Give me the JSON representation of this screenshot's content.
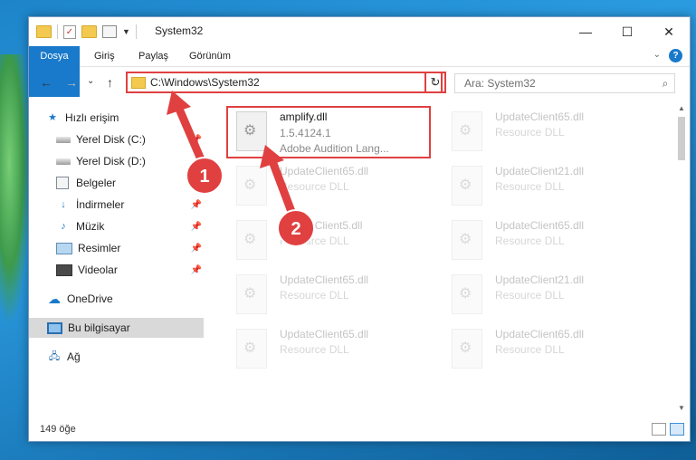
{
  "window": {
    "title": "System32",
    "minimize": "—",
    "maximize": "☐",
    "close": "✕"
  },
  "ribbon": {
    "tabs": [
      "Dosya",
      "Giriş",
      "Paylaş",
      "Görünüm"
    ],
    "help": "?"
  },
  "nav": {
    "back": "←",
    "forward": "→",
    "recent": "⌄",
    "up": "↑"
  },
  "address": {
    "path": "C:\\Windows\\System32",
    "refresh": "↻"
  },
  "search": {
    "placeholder": "Ara: System32",
    "icon": "search-icon"
  },
  "sidebar": {
    "items": [
      {
        "label": "Hızlı erişim",
        "icon": "star-icon"
      },
      {
        "label": "Yerel Disk (C:)",
        "icon": "drive-icon"
      },
      {
        "label": "Yerel Disk (D:)",
        "icon": "drive-icon"
      },
      {
        "label": "Belgeler",
        "icon": "documents-icon"
      },
      {
        "label": "İndirmeler",
        "icon": "download-icon"
      },
      {
        "label": "Müzik",
        "icon": "music-icon"
      },
      {
        "label": "Resimler",
        "icon": "pictures-icon"
      },
      {
        "label": "Videolar",
        "icon": "video-icon"
      },
      {
        "label": "OneDrive",
        "icon": "cloud-icon"
      },
      {
        "label": "Bu bilgisayar",
        "icon": "computer-icon"
      },
      {
        "label": "Ağ",
        "icon": "network-icon"
      }
    ]
  },
  "files": [
    {
      "name": "amplify.dll",
      "line1": "1.5.4124.1",
      "line2": "Adobe Audition Lang..."
    },
    {
      "name": "UpdateClient65.dll",
      "line1": "Resource DLL"
    },
    {
      "name": "UpdateClient65.dll",
      "line1": "Resource DLL"
    },
    {
      "name": "UpdateClient21.dll",
      "line1": "Resource DLL"
    },
    {
      "name": "UpdateClient5.dll",
      "line1": "Resource DLL"
    },
    {
      "name": "UpdateClient65.dll",
      "line1": "Resource DLL"
    },
    {
      "name": "UpdateClient65.dll",
      "line1": "Resource DLL"
    },
    {
      "name": "UpdateClient21.dll",
      "line1": "Resource DLL"
    },
    {
      "name": "UpdateClient65.dll",
      "line1": "Resource DLL"
    },
    {
      "name": "UpdateClient65.dll",
      "line1": "Resource DLL"
    }
  ],
  "status": {
    "count": "149 öğe"
  },
  "annotations": {
    "marker1": "1",
    "marker2": "2",
    "color": "#e04040"
  }
}
